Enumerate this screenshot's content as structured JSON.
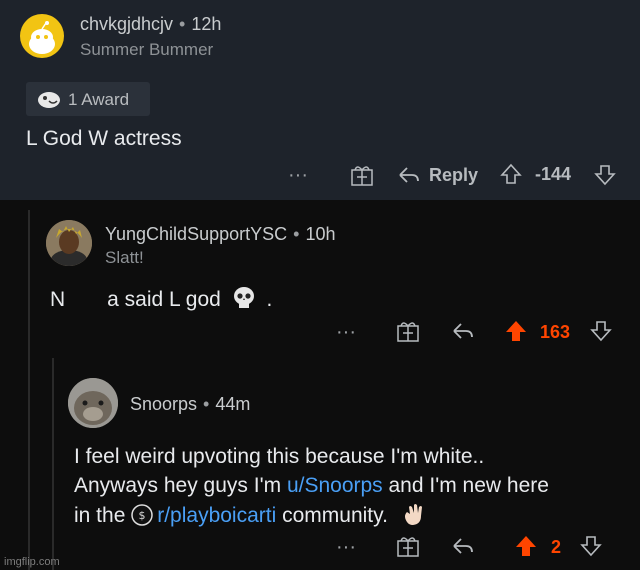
{
  "comment1": {
    "username": "chvkgjdhcjv",
    "age": "12h",
    "flair": "Summer Bummer",
    "award": "1 Award",
    "body": "L God W actress",
    "reply_label": "Reply",
    "score": "-144"
  },
  "comment2": {
    "username": "YungChildSupportYSC",
    "age": "10h",
    "flair": "Slatt!",
    "body_start": "N",
    "body_end": "a said L god",
    "body_tail": ".",
    "score": "163"
  },
  "comment3": {
    "username": "Snoorps",
    "age": "44m",
    "line1": "I feel weird upvoting this because I'm white..",
    "line2_pre": "Anyways hey guys I'm ",
    "user_link": "u/Snoorps",
    "line2_post": " and I'm new here",
    "line3_pre": "in the ",
    "sub_link": "r/playboicarti",
    "line3_post": " community.",
    "score": "2"
  },
  "watermark": "imgflip.com",
  "colors": {
    "upvote": "#ff4500",
    "link": "#4a9ff5"
  }
}
